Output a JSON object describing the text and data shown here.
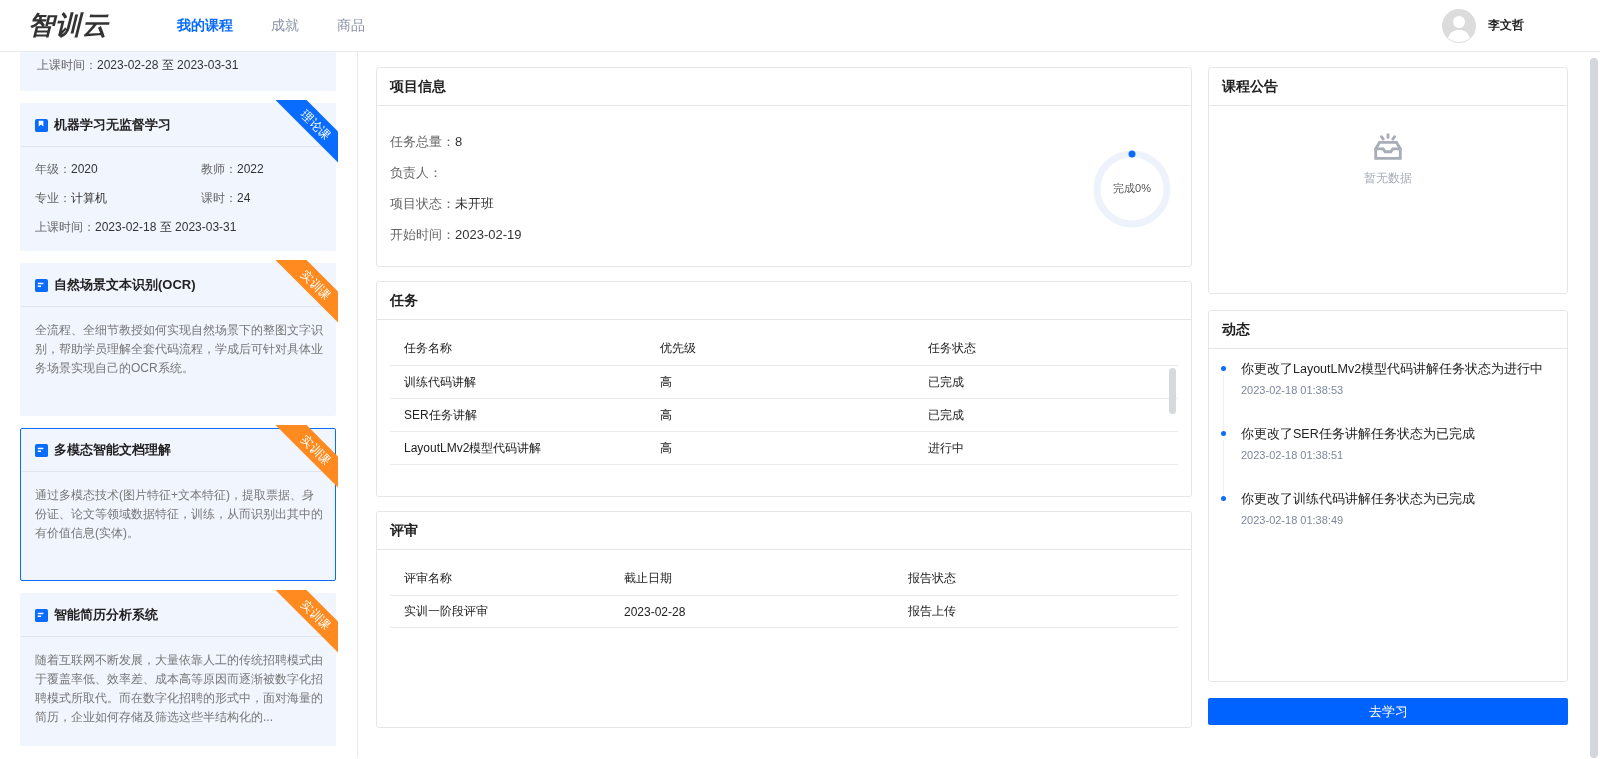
{
  "header": {
    "logo": "智训云",
    "nav": [
      {
        "label": "我的课程",
        "selected": true
      },
      {
        "label": "成就",
        "selected": false
      },
      {
        "label": "商品",
        "selected": false
      }
    ],
    "user": {
      "name": "李文哲"
    }
  },
  "courses": [
    {
      "kind": "meta",
      "selected": false,
      "schedule": {
        "label": "上课时间：",
        "value": "2023-02-28 至 2023-03-31"
      }
    },
    {
      "kind": "meta",
      "selected": false,
      "title": "机器学习无监督学习",
      "tag": {
        "label": "理论课",
        "color": "#0a6cff"
      },
      "fields": [
        {
          "label": "年级：",
          "value": "2020"
        },
        {
          "label": "教师：",
          "value": "2022"
        },
        {
          "label": "专业：",
          "value": "计算机"
        },
        {
          "label": "课时：",
          "value": "24"
        }
      ],
      "schedule": {
        "label": "上课时间：",
        "value": "2023-02-18 至 2023-03-31"
      }
    },
    {
      "kind": "desc",
      "selected": false,
      "title": "自然场景文本识别(OCR)",
      "tag": {
        "label": "实训课",
        "color": "#ff8a1f"
      },
      "description": "全流程、全细节教授如何实现自然场景下的整图文字识别，帮助学员理解全套代码流程，学成后可针对具体业务场景实现自己的OCR系统。"
    },
    {
      "kind": "desc",
      "selected": true,
      "title": "多模态智能文档理解",
      "tag": {
        "label": "实训课",
        "color": "#ff8a1f"
      },
      "description": "通过多模态技术(图片特征+文本特征)，提取票据、身份证、论文等领域数据特征，训练，从而识别出其中的有价值信息(实体)。"
    },
    {
      "kind": "desc",
      "selected": false,
      "title": "智能简历分析系统",
      "tag": {
        "label": "实训课",
        "color": "#ff8a1f"
      },
      "description": "随着互联网不断发展，大量依靠人工的传统招聘模式由于覆盖率低、效率差、成本高等原因而逐渐被数字化招聘模式所取代。而在数字化招聘的形式中，面对海量的简历，企业如何存储及筛选这些半结构化的..."
    }
  ],
  "project": {
    "title": "项目信息",
    "fields": [
      {
        "label": "任务总量：",
        "value": "8"
      },
      {
        "label": "负责人："
      },
      {
        "label": "项目状态：",
        "value": "未开班"
      },
      {
        "label": "开始时间：",
        "value": "2023-02-19"
      }
    ],
    "progress": {
      "label": "完成0%",
      "level": 0
    }
  },
  "tasks": {
    "title": "任务",
    "columns": [
      "任务名称",
      "优先级",
      "任务状态"
    ],
    "rows": [
      [
        "训练代码讲解",
        "高",
        "已完成"
      ],
      [
        "SER任务讲解",
        "高",
        "已完成"
      ],
      [
        "LayoutLMv2模型代码讲解",
        "高",
        "进行中"
      ]
    ]
  },
  "review": {
    "title": "评审",
    "columns": [
      "评审名称",
      "截止日期",
      "报告状态"
    ],
    "rows": [
      [
        "实训一阶段评审",
        "2023-02-28",
        "报告上传"
      ]
    ]
  },
  "announcement": {
    "title": "课程公告",
    "empty_text": "暂无数据"
  },
  "activity": {
    "title": "动态",
    "items": [
      {
        "text": "你更改了LayoutLMv2模型代码讲解任务状态为进行中",
        "time": "2023-02-18 01:38:53"
      },
      {
        "text": "你更改了SER任务讲解任务状态为已完成",
        "time": "2023-02-18 01:38:51"
      },
      {
        "text": "你更改了训练代码讲解任务状态为已完成",
        "time": "2023-02-18 01:38:49"
      }
    ]
  },
  "action_button": "去学习"
}
